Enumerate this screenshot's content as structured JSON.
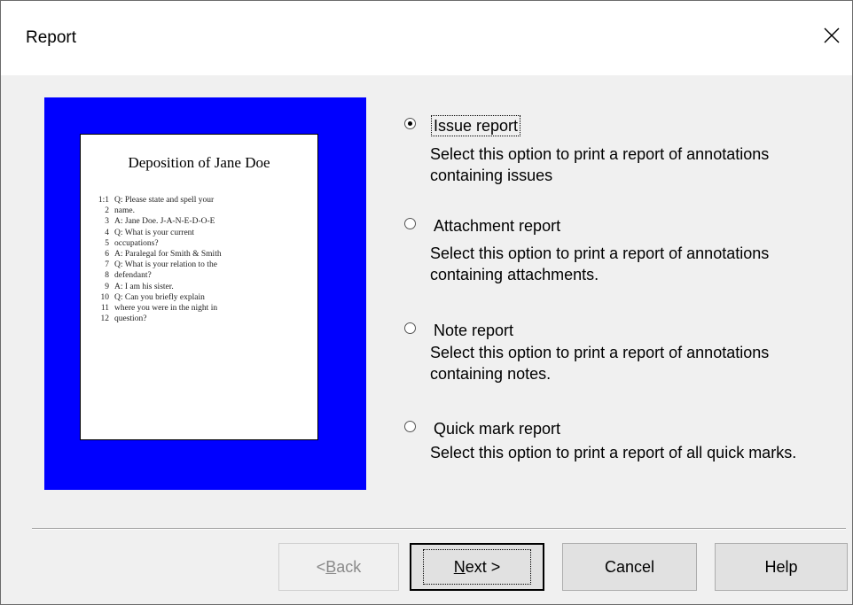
{
  "window": {
    "title": "Report",
    "close_icon": "close-icon"
  },
  "preview": {
    "background_color": "#0000ff",
    "doc_title": "Deposition of  Jane Doe",
    "lines": [
      {
        "num": "1:1",
        "text": "Q: Please state and spell your"
      },
      {
        "num": "2",
        "text": "name."
      },
      {
        "num": "3",
        "text": "A: Jane Doe. J-A-N-E-D-O-E"
      },
      {
        "num": "4",
        "text": "Q: What is your current"
      },
      {
        "num": "5",
        "text": "occupations?"
      },
      {
        "num": "6",
        "text": "A: Paralegal for Smith & Smith"
      },
      {
        "num": "7",
        "text": "Q: What is your relation to the"
      },
      {
        "num": "8",
        "text": "defendant?"
      },
      {
        "num": "9",
        "text": "A: I am his sister."
      },
      {
        "num": "10",
        "text": "Q: Can you briefly explain"
      },
      {
        "num": "11",
        "text": "where you were in the night in"
      },
      {
        "num": "12",
        "text": "question?"
      }
    ]
  },
  "options": [
    {
      "label": "Issue report",
      "description": "Select this option to print a report of annotations containing issues",
      "checked": true
    },
    {
      "label": "Attachment report",
      "description": "Select this option to print a report of annotations containing attachments.",
      "checked": false
    },
    {
      "label": "Note report",
      "description": "Select this option to print a report of annotations containing notes.",
      "checked": false
    },
    {
      "label": "Quick mark report",
      "description": "Select this option to print a report of all quick marks.",
      "checked": false
    }
  ],
  "buttons": {
    "back_prefix": "< ",
    "back_mnemonic": "B",
    "back_rest": "ack",
    "next_mnemonic": "N",
    "next_rest": "ext >",
    "cancel": "Cancel",
    "help": "Help"
  }
}
